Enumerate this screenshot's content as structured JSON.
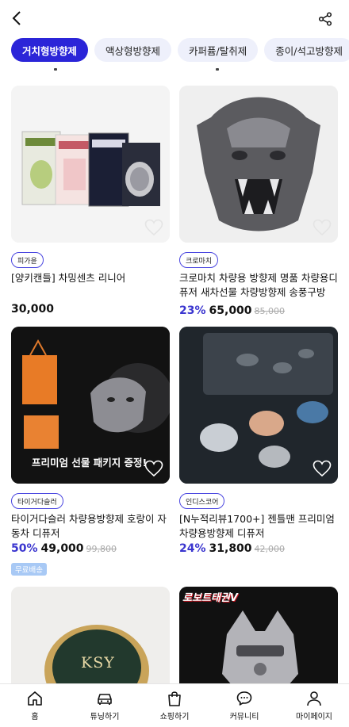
{
  "header": {
    "back_icon": "chevron-left-icon",
    "share_icon": "share-icon"
  },
  "categories": [
    {
      "label": "거치형방향제",
      "active": true
    },
    {
      "label": "액상형방향제",
      "active": false
    },
    {
      "label": "카퍼퓸/탈취제",
      "active": false
    },
    {
      "label": "종이/석고방향제",
      "active": false
    }
  ],
  "products": [
    {
      "brand": "피가윤",
      "name": "[양키캔들] 차밍센츠 리니어",
      "discount": "",
      "price": "30,000",
      "original_price": ""
    },
    {
      "brand": "크로마치",
      "name": "크로마치 차량용 방향제 명품 차량용디퓨저 새차선물 차량방향제 송풍구방향...",
      "discount": "23%",
      "price": "65,000",
      "original_price": "85,000"
    },
    {
      "brand": "타이거다슬러",
      "name": "타이거다슬러 차량용방향제 호랑이 자동차 디퓨저",
      "discount": "50%",
      "price": "49,000",
      "original_price": "99,800",
      "badge": "무료배송",
      "image_text": "프리미엄 선물 패키지 증정!"
    },
    {
      "brand": "인디스코어",
      "name": "[N누적리뷰1700+] 젠틀맨 프리미엄 차량용방향제 디퓨저",
      "discount": "24%",
      "price": "31,800",
      "original_price": "42,000"
    },
    {
      "brand": "",
      "name": "",
      "image_text": "KSY"
    },
    {
      "brand": "",
      "name": "",
      "image_text": "로보트태권V"
    }
  ],
  "bottom_nav": [
    {
      "label": "홈",
      "icon": "home-icon"
    },
    {
      "label": "튜닝하기",
      "icon": "car-icon"
    },
    {
      "label": "쇼핑하기",
      "icon": "shopping-bag-icon"
    },
    {
      "label": "커뮤니티",
      "icon": "chat-bubble-icon"
    },
    {
      "label": "마이페이지",
      "icon": "person-icon"
    }
  ]
}
